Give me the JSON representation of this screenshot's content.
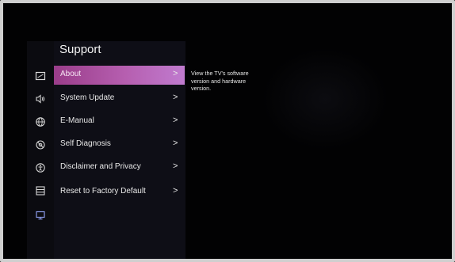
{
  "header": {
    "title": "Support"
  },
  "rail": {
    "icons": [
      "picture-settings-icon",
      "sound-settings-icon",
      "network-globe-icon",
      "general-settings-icon",
      "accessibility-icon",
      "system-list-icon",
      "support-monitor-icon"
    ]
  },
  "menu": {
    "items": [
      {
        "label": "About",
        "selected": true
      },
      {
        "label": "System Update"
      },
      {
        "label": "E-Manual"
      },
      {
        "label": "Self Diagnosis"
      },
      {
        "label": "Disclaimer and Privacy"
      },
      {
        "label": "Reset to Factory Default"
      }
    ],
    "chevron": ">"
  },
  "description": {
    "text": "View the TV's software version and hardware version."
  },
  "colors": {
    "selected_gradient_start": "#9a3d8a",
    "selected_gradient_end": "#c07bcf",
    "background": "#020203",
    "panel": "#0e0e16"
  }
}
